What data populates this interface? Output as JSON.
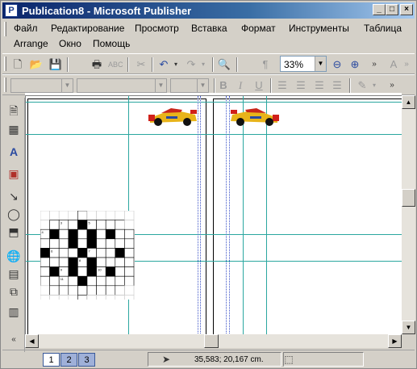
{
  "window": {
    "title": "Publication8 - Microsoft Publisher",
    "app_icon_glyph": "P",
    "min_glyph": "_",
    "max_glyph": "□",
    "close_glyph": "×"
  },
  "menu": {
    "items": [
      "Файл",
      "Редактирование",
      "Просмотр",
      "Вставка",
      "Формат",
      "Инструменты",
      "Таблица",
      "Arrange",
      "Окно",
      "Помощь"
    ]
  },
  "standard_toolbar": {
    "zoom_value": "33%",
    "icons": [
      "new-icon",
      "open-icon",
      "save-icon",
      "print-icon",
      "spell-check-icon",
      "cut-icon",
      "undo-icon",
      "redo-icon",
      "zoom-page-icon",
      "special-characters-icon",
      "zoom-out-icon",
      "zoom-in-icon",
      "more-icon",
      "style-icon"
    ]
  },
  "formatting_toolbar": {
    "bold_label": "B",
    "italic_label": "I",
    "underline_label": "U",
    "font_style_value": "",
    "font_name_value": "",
    "font_size_value": ""
  },
  "left_toolbar": {
    "icons": [
      "text-box-icon",
      "table-icon",
      "wordart-icon",
      "picture-frame-icon",
      "line-icon",
      "oval-icon",
      "autoshape-icon",
      "web-icon",
      "form-control-icon",
      "object-icon",
      "design-gallery-icon",
      "more-tools-icon"
    ]
  },
  "document": {
    "crossword": {
      "rows": 10,
      "cols": 10,
      "black_cells": [
        [
          2,
          1
        ],
        [
          2,
          3
        ],
        [
          2,
          5
        ],
        [
          2,
          7
        ],
        [
          3,
          3
        ],
        [
          3,
          5
        ],
        [
          4,
          0
        ],
        [
          4,
          4
        ],
        [
          4,
          8
        ],
        [
          5,
          3
        ],
        [
          5,
          5
        ],
        [
          6,
          1
        ],
        [
          6,
          3
        ],
        [
          6,
          5
        ],
        [
          6,
          7
        ],
        [
          1,
          4
        ],
        [
          7,
          4
        ]
      ],
      "unused_cells": [
        [
          0,
          0
        ],
        [
          0,
          1
        ],
        [
          0,
          2
        ],
        [
          0,
          3
        ],
        [
          0,
          5
        ],
        [
          0,
          6
        ],
        [
          0,
          7
        ],
        [
          0,
          8
        ],
        [
          0,
          9
        ],
        [
          1,
          0
        ],
        [
          1,
          9
        ],
        [
          8,
          0
        ],
        [
          8,
          9
        ],
        [
          9,
          0
        ],
        [
          9,
          1
        ],
        [
          9,
          2
        ],
        [
          9,
          3
        ],
        [
          9,
          5
        ],
        [
          9,
          6
        ],
        [
          9,
          7
        ],
        [
          9,
          8
        ],
        [
          9,
          9
        ]
      ],
      "numbers": [
        {
          "r": 1,
          "c": 2,
          "n": "3"
        },
        {
          "r": 1,
          "c": 5,
          "n": "5"
        },
        {
          "r": 2,
          "c": 0,
          "n": "4"
        },
        {
          "r": 4,
          "c": 1,
          "n": "6"
        },
        {
          "r": 4,
          "c": 5,
          "n": "7"
        },
        {
          "r": 5,
          "c": 4,
          "n": "8"
        },
        {
          "r": 6,
          "c": 2,
          "n": "9"
        },
        {
          "r": 6,
          "c": 6,
          "n": "10"
        },
        {
          "r": 7,
          "c": 2,
          "n": "11"
        }
      ]
    }
  },
  "statusbar": {
    "pages": [
      "1",
      "2",
      "3"
    ],
    "active_page": "1",
    "coordinates": "35,583; 20,167 cm.",
    "pointer_icon": "pointer-icon",
    "size_icon": "object-size-icon"
  },
  "colors": {
    "titlebar_start": "#0a246a",
    "guide": "#2ba7a0",
    "margin_guide": "#3d54c8"
  }
}
